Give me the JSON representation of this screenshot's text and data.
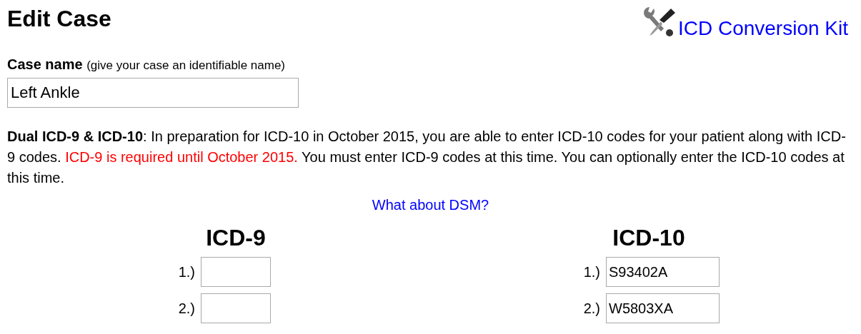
{
  "page_title": "Edit Case",
  "conversion_link": "ICD Conversion Kit",
  "case_name": {
    "label": "Case name",
    "hint": "(give your case an identifiable name)",
    "value": "Left Ankle"
  },
  "notice": [
    {
      "kind": "plain",
      "text": "**Dual ICD-9 & ICD-10**: In preparation for ICD-10 in October 2015, you are able to enter ICD-10 codes for your patient along with ICD-9 codes. "
    },
    {
      "kind": "warning",
      "text": "ICD-9 is required until October 2015."
    },
    {
      "kind": "plain",
      "text": " You must enter ICD-9 codes at this time. You can optionally enter the ICD-10 codes at this time."
    }
  ],
  "dsm_link": "What about DSM?",
  "code_columns": [
    {
      "heading": "ICD-9",
      "rows": [
        {
          "number": "1.)"
        },
        {
          "number": "2.)"
        }
      ]
    },
    {
      "heading": "ICD-10",
      "rows": [
        {
          "number": "1.)",
          "value": "S93402A"
        },
        {
          "number": "2.)",
          "value": "W5803XA"
        }
      ]
    }
  ]
}
